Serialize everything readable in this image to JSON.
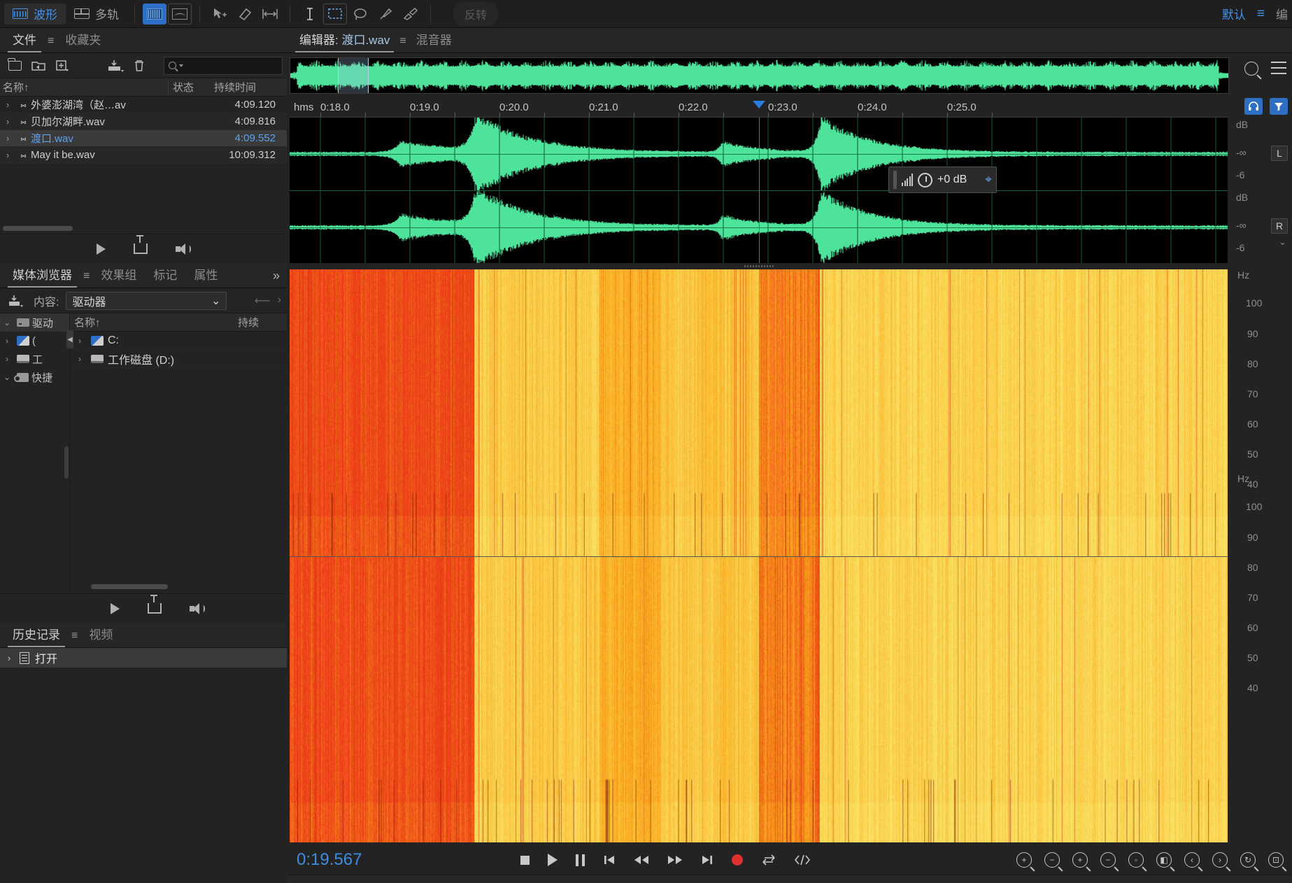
{
  "toolbar": {
    "waveform_label": "波形",
    "multitrack_label": "多轨",
    "revert_label": "反转",
    "workspace_label": "默认",
    "workspace_menu_glyph": "≡",
    "more_label": "编"
  },
  "files_panel": {
    "tabs": [
      {
        "label": "文件",
        "active": true
      },
      {
        "label": "收藏夹",
        "active": false
      }
    ],
    "menu_glyph": "≡",
    "search_placeholder": "",
    "columns": {
      "name": "名称",
      "sort_arrow": "↑",
      "status": "状态",
      "duration": "持续时间"
    },
    "rows": [
      {
        "arrow": "›",
        "name": "外婆澎湖湾（赵…av",
        "status": "",
        "duration": "4:09.120",
        "selected": false
      },
      {
        "arrow": "›",
        "name": "贝加尔湖畔.wav",
        "status": "",
        "duration": "4:09.816",
        "selected": false
      },
      {
        "arrow": "›",
        "name": "渡口.wav",
        "status": "",
        "duration": "4:09.552",
        "selected": true
      },
      {
        "arrow": "›",
        "name": "May it be.wav",
        "status": "",
        "duration": "10:09.312",
        "selected": false
      }
    ]
  },
  "media_browser": {
    "tabs": [
      {
        "label": "媒体浏览器",
        "active": true
      },
      {
        "label": "效果组",
        "active": false
      },
      {
        "label": "标记",
        "active": false
      },
      {
        "label": "属性",
        "active": false
      }
    ],
    "menu_glyph": "≡",
    "more_glyph": "»",
    "content_label": "内容:",
    "content_value": "驱动器",
    "tree": [
      {
        "arrow": "⌄",
        "label": "驱动",
        "icon": "drive-icon"
      },
      {
        "arrow": "›",
        "label": "(",
        "icon": "windows-drive-icon"
      },
      {
        "arrow": "›",
        "label": "工",
        "icon": "hdd-icon"
      },
      {
        "arrow": "⌄",
        "label": "快捷",
        "icon": "shortcut-icon"
      }
    ],
    "columns": {
      "name": "名称",
      "sort_arrow": "↑",
      "duration": "持续"
    },
    "rows": [
      {
        "arrow": "›",
        "name": "C:",
        "icon": "windows-drive-icon"
      },
      {
        "arrow": "›",
        "name": "工作磁盘 (D:)",
        "icon": "hdd-icon"
      }
    ]
  },
  "history_panel": {
    "tabs": [
      {
        "label": "历史记录",
        "active": true
      },
      {
        "label": "视频",
        "active": false
      }
    ],
    "menu_glyph": "≡",
    "entries": [
      {
        "arrow": "›",
        "label": "打开"
      }
    ]
  },
  "editor": {
    "tabs": [
      {
        "label": "编辑器: ",
        "file": "渡口.wav",
        "active": true
      },
      {
        "label": "混音器",
        "file": "",
        "active": false
      }
    ],
    "menu_glyph": "≡",
    "ruler_unit": "hms",
    "ruler_ticks": [
      "0:18.0",
      "0:19.0",
      "0:20.0",
      "0:21.0",
      "0:22.0",
      "0:23.0",
      "0:24.0",
      "0:25.0"
    ],
    "db_labels": [
      "dB",
      "-∞",
      "-6"
    ],
    "channel_labels": [
      "L",
      "R"
    ],
    "hz_labels": [
      "Hz",
      "100",
      "90",
      "80",
      "70",
      "60",
      "50",
      "40"
    ],
    "gain_overlay": {
      "value": "+0 dB",
      "pin_glyph": "⌖"
    },
    "playhead_time": "0:19.567"
  },
  "transport": {
    "time": "0:19.567",
    "buttons": [
      {
        "name": "stop",
        "glyph": "■"
      },
      {
        "name": "play",
        "glyph": "▶"
      },
      {
        "name": "pause",
        "glyph": "❚❚"
      },
      {
        "name": "skip-start",
        "glyph": "|◀"
      },
      {
        "name": "rewind",
        "glyph": "◀◀"
      },
      {
        "name": "fast-forward",
        "glyph": "▶▶"
      },
      {
        "name": "skip-end",
        "glyph": "▶|"
      },
      {
        "name": "record",
        "glyph": "●"
      },
      {
        "name": "loop",
        "glyph": "⇄"
      },
      {
        "name": "shuttle",
        "glyph": "⟨⟩"
      }
    ],
    "zoom_buttons": [
      "zoom-in-amplitude",
      "zoom-out-amplitude",
      "zoom-in-time",
      "zoom-out-time",
      "zoom-out-full",
      "zoom-to-selection",
      "zoom-in-left",
      "zoom-in-right",
      "zoom-reset",
      "zoom-full-view"
    ]
  },
  "colors": {
    "accent": "#2d6fc4",
    "selected_text": "#5ba3ef",
    "waveform": "#4ee39b",
    "playhead": "#e23b3b",
    "record": "#e03131",
    "panel_bg": "#232323",
    "toolbar_bg": "#1f1f1f"
  }
}
